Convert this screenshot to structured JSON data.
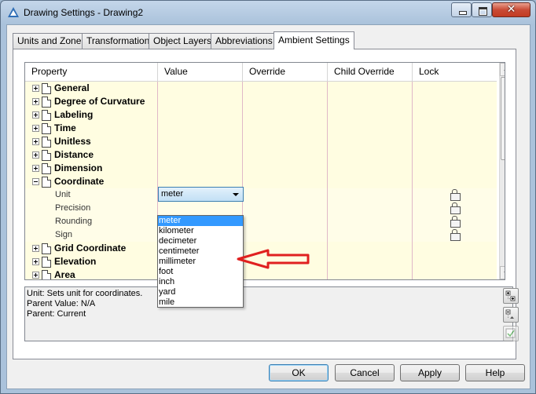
{
  "window": {
    "title": "Drawing Settings - Drawing2",
    "close_glyph": "✕"
  },
  "tabs": [
    {
      "label": "Units and Zone"
    },
    {
      "label": "Transformation"
    },
    {
      "label": "Object Layers"
    },
    {
      "label": "Abbreviations"
    },
    {
      "label": "Ambient Settings",
      "active": true
    }
  ],
  "grid": {
    "columns": [
      "Property",
      "Value",
      "Override",
      "Child Override",
      "Lock"
    ],
    "categories_before": [
      {
        "label": "General"
      },
      {
        "label": "Degree of Curvature"
      },
      {
        "label": "Labeling"
      },
      {
        "label": "Time"
      },
      {
        "label": "Unitless"
      },
      {
        "label": "Distance"
      },
      {
        "label": "Dimension"
      }
    ],
    "expanded": {
      "label": "Coordinate",
      "children": [
        {
          "label": "Unit",
          "locked": true
        },
        {
          "label": "Precision",
          "locked": true
        },
        {
          "label": "Rounding",
          "locked": true
        },
        {
          "label": "Sign",
          "locked": true
        }
      ]
    },
    "categories_after": [
      {
        "label": "Grid Coordinate"
      },
      {
        "label": "Elevation"
      },
      {
        "label": "Area"
      }
    ]
  },
  "unit_combo": {
    "value": "meter",
    "options": [
      "meter",
      "kilometer",
      "decimeter",
      "centimeter",
      "millimeter",
      "foot",
      "inch",
      "yard",
      "mile"
    ],
    "selected_index": 0
  },
  "description": {
    "lines": [
      "Unit: Sets unit for coordinates.",
      "Parent Value: N/A",
      "Parent: Current"
    ]
  },
  "buttons": {
    "ok": "OK",
    "cancel": "Cancel",
    "apply": "Apply",
    "help": "Help"
  },
  "annotation": {
    "arrow_color": "#e02020"
  },
  "colors": {
    "selection": "#3399ff",
    "row_bg": "#fffde1"
  }
}
